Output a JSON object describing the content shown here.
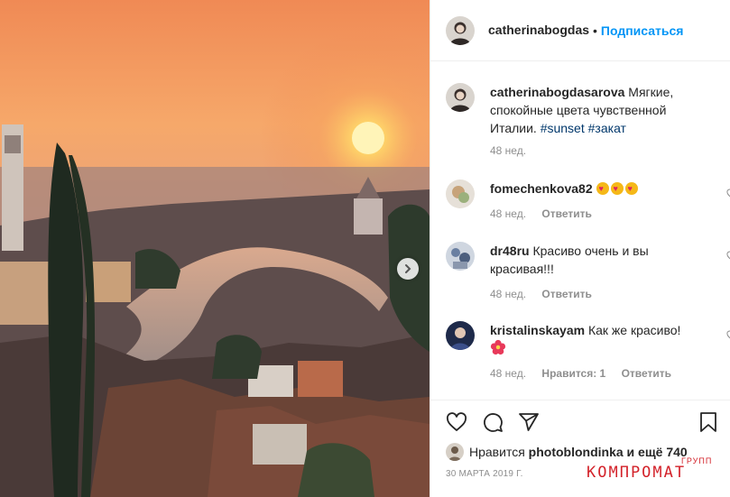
{
  "post": {
    "author": "catherinabogdasarova",
    "header_username": "catherinabogdasarova",
    "dot": "•",
    "follow_label": "Подписаться",
    "caption": {
      "username": "catherinabogdasarova",
      "text": "Мягкие, спокойные цвета чувственной Италии.",
      "hashtags": [
        "#sunset",
        "#закат"
      ],
      "time": "48 нед."
    },
    "comments": [
      {
        "username": "fomechenkova82",
        "text": "",
        "emoji": [
          "heart-eyes",
          "heart-eyes",
          "heart-eyes"
        ],
        "time": "48 нед.",
        "reply": "Ответить",
        "likes": ""
      },
      {
        "username": "dr48ru",
        "text": "Красиво очень и вы красивая!!!",
        "time": "48 нед.",
        "reply": "Ответить",
        "likes": ""
      },
      {
        "username": "kristalinskayam",
        "text": "Как же красиво!",
        "emoji": [
          "hibiscus"
        ],
        "time": "48 нед.",
        "reply": "Ответить",
        "likes": "Нравится: 1"
      }
    ],
    "liked_by_prefix": "Нравится",
    "liked_by_user": "photoblondinka",
    "liked_by_suffix": "и ещё 740",
    "date": "30 МАРТА 2019 Г."
  },
  "watermark": {
    "main": "КОМПРОМАТ",
    "sub": "ГРУПП"
  },
  "icons": [
    "next-arrow-icon",
    "heart-icon",
    "comment-icon",
    "share-icon",
    "bookmark-icon"
  ],
  "colors": {
    "link": "#0095f6",
    "hashtag": "#00376b",
    "muted": "#8e8e8e",
    "watermark": "#d3222a",
    "sun": "#ffd24a"
  }
}
